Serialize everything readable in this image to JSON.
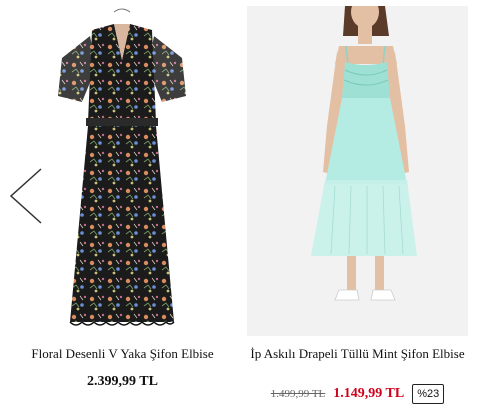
{
  "products": [
    {
      "title": "Floral Desenli V Yaka Şifon Elbise",
      "price": "2.399,99 TL"
    },
    {
      "title": "İp Askılı Drapeli Tüllü Mint Şifon Elbise",
      "old_price": "1.499,99 TL",
      "price": "1.149,99 TL",
      "discount": "%23"
    }
  ],
  "icons": {
    "prev": "chevron-left-icon"
  },
  "colors": {
    "sale_price": "#d0021b",
    "mint_dress": "#a8e6dd",
    "floral_dress": "#1a1a1a",
    "photo_background": "#f2f2f2"
  }
}
